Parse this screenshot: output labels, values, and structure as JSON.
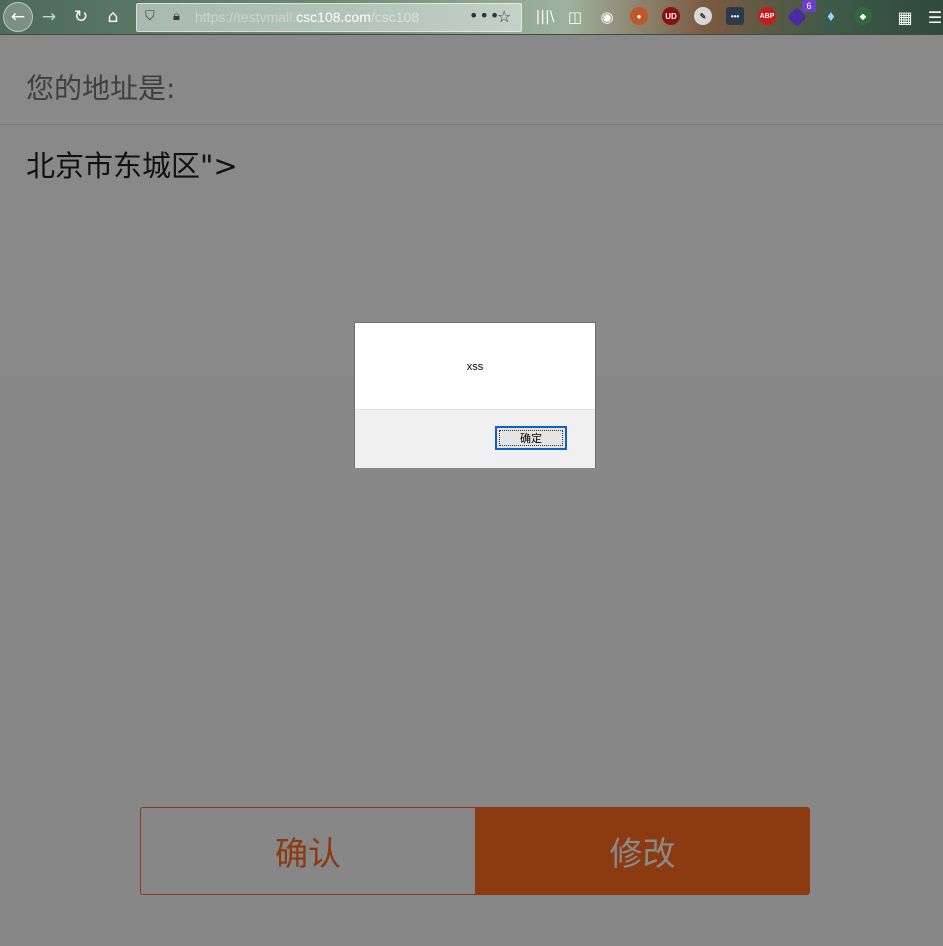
{
  "browser": {
    "url_prefix": "https://testvmall.",
    "url_host": "csc108.com",
    "url_path": "/csc108",
    "icons": [
      "back-icon",
      "forward-icon",
      "reload-icon",
      "home-icon",
      "shield-icon",
      "lock-icon",
      "more-icon",
      "star-icon",
      "library-icon",
      "sidebar-icon",
      "account-icon",
      "extension-icon",
      "ublock-icon",
      "extension-icon",
      "dots-icon",
      "adblock-icon",
      "extension-icon",
      "gem-icon",
      "extension-icon",
      "gift-icon",
      "menu-icon"
    ],
    "abp_label": "ABP",
    "ublock_label": "UD",
    "badge_count": "6"
  },
  "page": {
    "address_title": "您的地址是:",
    "address_value": "北京市东城区\">",
    "confirm_label": "确认",
    "modify_label": "修改"
  },
  "dialog": {
    "message": "xss",
    "ok_label": "确定"
  },
  "colors": {
    "accent": "#8c3a10",
    "overlay": "#878787",
    "focus": "#0a62c7"
  }
}
